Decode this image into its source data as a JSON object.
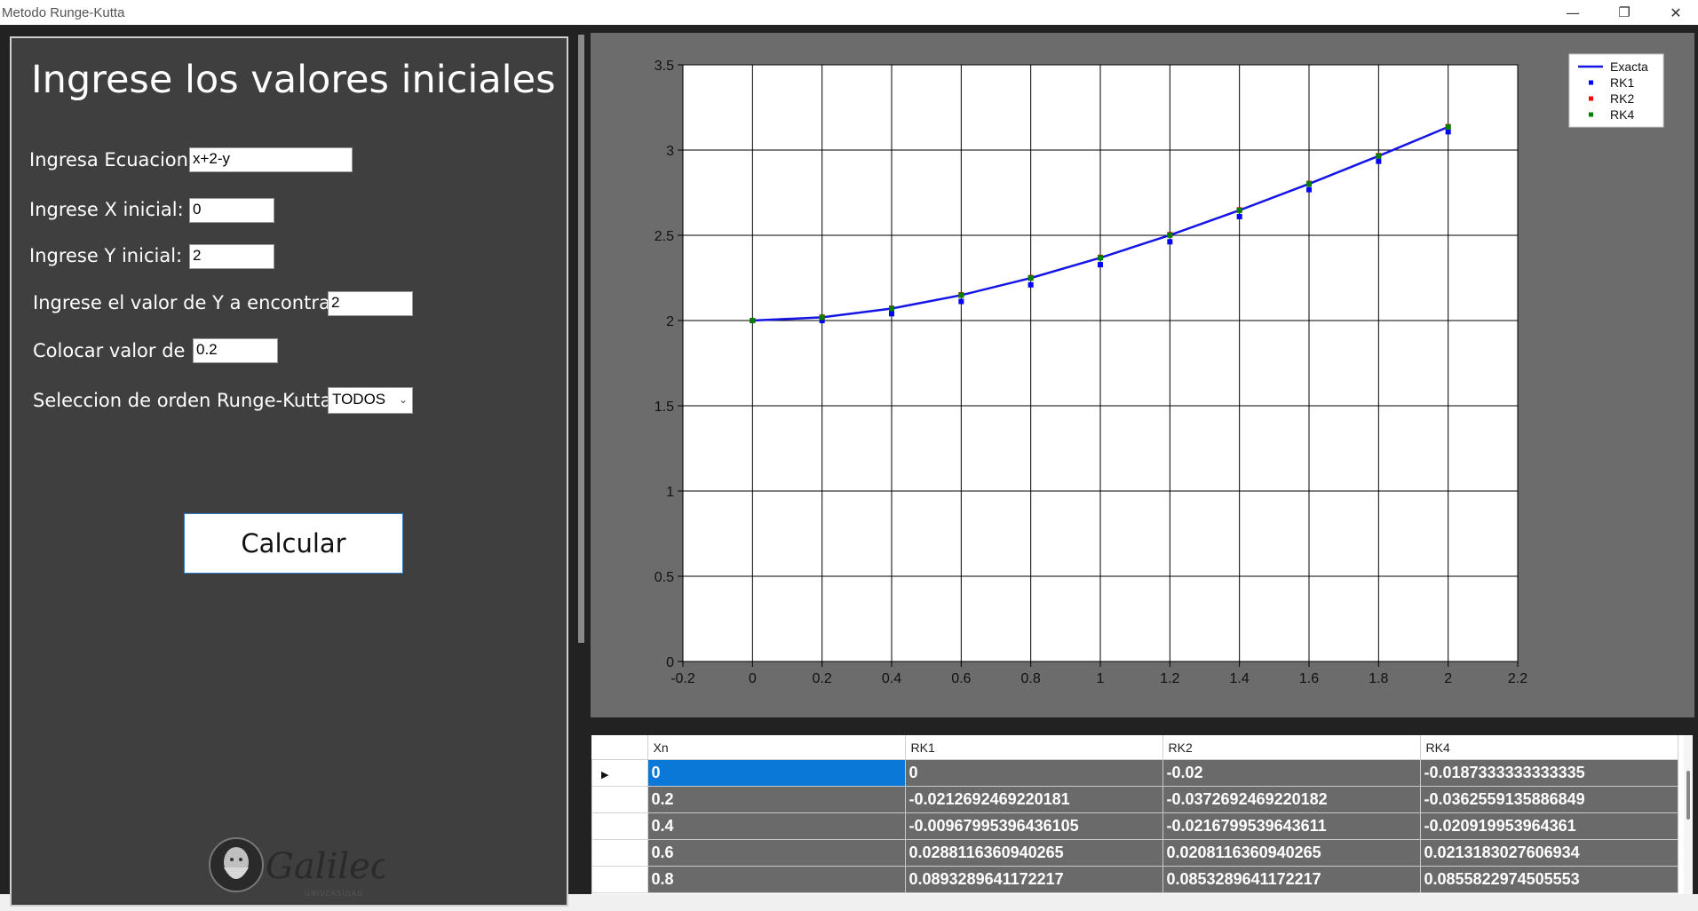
{
  "window": {
    "title": "Metodo Runge-Kutta",
    "minimize_glyph": "—",
    "restore_glyph": "❐",
    "close_glyph": "✕"
  },
  "form": {
    "heading": "Ingrese los valores iniciales",
    "equation_label": "Ingresa Ecuacion:",
    "equation_value": "x+2-y",
    "x0_label": "Ingrese X inicial:",
    "x0_value": "0",
    "y0_label": "Ingrese Y inicial:",
    "y0_value": "2",
    "yfind_label": "Ingrese el valor de Y a encontrar:",
    "yfind_value": "2",
    "h_label": "Colocar valor de h:",
    "h_value": "0.2",
    "order_label": "Seleccion de orden Runge-Kutta:",
    "order_value": "TODOS",
    "calc_button": "Calcular"
  },
  "logo": {
    "name": "galileo-logo",
    "text": "Galileo",
    "subtext": "UNIVERSIDAD"
  },
  "chart_data": {
    "type": "line",
    "title": "",
    "xlabel": "",
    "ylabel": "",
    "xlim": [
      -0.2,
      2.2
    ],
    "ylim": [
      0,
      3.5
    ],
    "xticks": [
      -0.2,
      0,
      0.2,
      0.4,
      0.6,
      0.8,
      1,
      1.2,
      1.4,
      1.6,
      1.8,
      2,
      2.2
    ],
    "yticks": [
      0,
      0.5,
      1,
      1.5,
      2,
      2.5,
      3,
      3.5
    ],
    "grid": true,
    "legend_position": "top-right",
    "series": [
      {
        "name": "Exacta",
        "style": "line",
        "color": "#1515e6",
        "x": [
          0,
          0.2,
          0.4,
          0.6,
          0.8,
          1,
          1.2,
          1.4,
          1.6,
          1.8,
          2
        ],
        "y": [
          2,
          2.0187,
          2.0703,
          2.1488,
          2.2493,
          2.3679,
          2.5012,
          2.6466,
          2.8019,
          2.9653,
          3.1353
        ]
      },
      {
        "name": "RK1",
        "style": "marker",
        "color": "#0000ff",
        "x": [
          0,
          0.2,
          0.4,
          0.6,
          0.8,
          1,
          1.2,
          1.4,
          1.6,
          1.8,
          2
        ],
        "y": [
          2,
          2,
          2.04,
          2.112,
          2.2096,
          2.3277,
          2.4621,
          2.6097,
          2.7678,
          2.9342,
          3.1074
        ]
      },
      {
        "name": "RK2",
        "style": "marker",
        "color": "#ff0000",
        "x": [
          0,
          0.2,
          0.4,
          0.6,
          0.8,
          1,
          1.2,
          1.4,
          1.6,
          1.8,
          2
        ],
        "y": [
          2,
          2.02,
          2.0724,
          2.1514,
          2.2521,
          2.3707,
          2.504,
          2.6493,
          2.8044,
          2.9676,
          3.1374
        ]
      },
      {
        "name": "RK4",
        "style": "marker",
        "color": "#008000",
        "x": [
          0,
          0.2,
          0.4,
          0.6,
          0.8,
          1,
          1.2,
          1.4,
          1.6,
          1.8,
          2
        ],
        "y": [
          2,
          2.0187,
          2.0703,
          2.1488,
          2.2493,
          2.3679,
          2.5012,
          2.6466,
          2.8019,
          2.9653,
          3.1353
        ]
      }
    ]
  },
  "table": {
    "columns": [
      "Xn",
      "RK1",
      "RK2",
      "RK4"
    ],
    "current_row_glyph": "▶",
    "rows": [
      [
        "0",
        "0",
        "-0.02",
        "-0.0187333333333335"
      ],
      [
        "0.2",
        "-0.0212692469220181",
        "-0.0372692469220182",
        "-0.0362559135886849"
      ],
      [
        "0.4",
        "-0.00967995396436105",
        "-0.0216799539643611",
        "-0.020919953964361"
      ],
      [
        "0.6",
        "0.0288116360940265",
        "0.0208116360940265",
        "0.0213183027606934"
      ],
      [
        "0.8",
        "0.0893289641172217",
        "0.0853289641172217",
        "0.0855822974505553"
      ]
    ]
  }
}
